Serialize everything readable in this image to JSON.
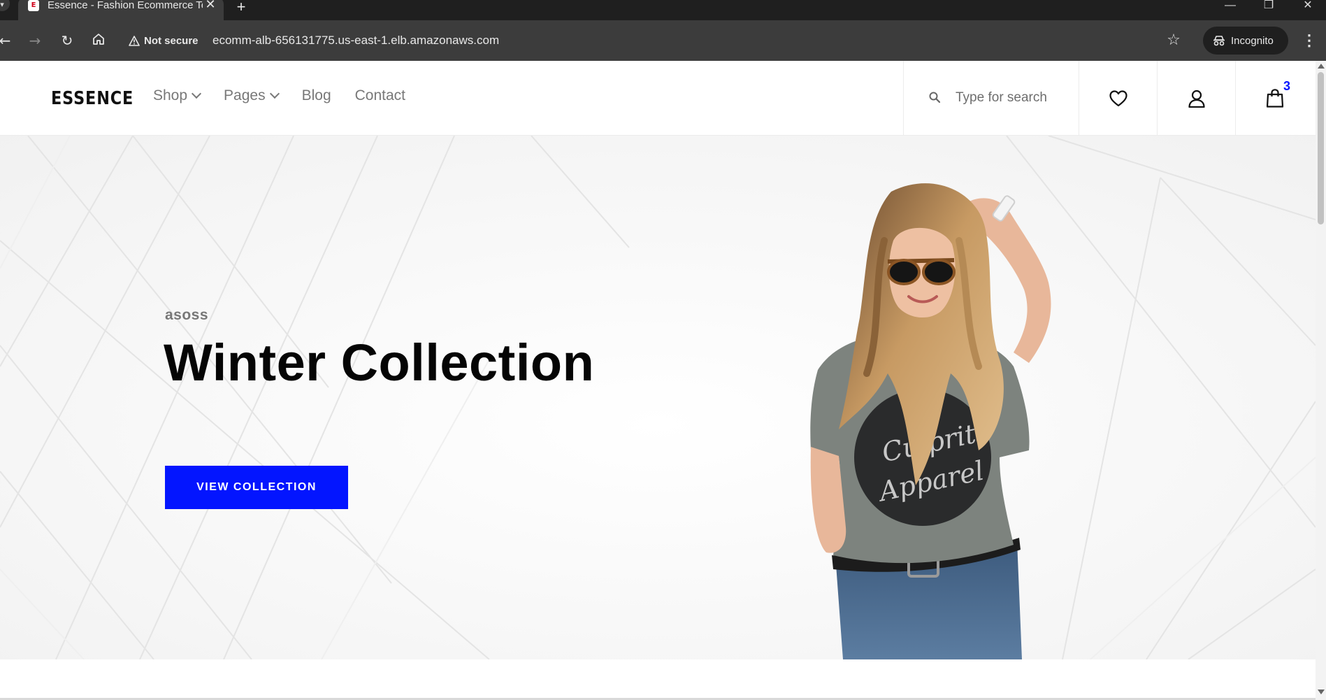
{
  "browser": {
    "tab": {
      "title": "Essence - Fashion Ecommerce Template",
      "favicon_letter": "E"
    },
    "new_tab_label": "+",
    "security_label": "Not secure",
    "url": "ecomm-alb-656131775.us-east-1.elb.amazonaws.com",
    "profile_label": "Incognito"
  },
  "site": {
    "logo": "ESSENCE",
    "nav": [
      {
        "label": "Shop",
        "has_dropdown": true
      },
      {
        "label": "Pages",
        "has_dropdown": true
      },
      {
        "label": "Blog",
        "has_dropdown": false
      },
      {
        "label": "Contact",
        "has_dropdown": false
      }
    ],
    "search": {
      "placeholder": "Type for search",
      "value": ""
    },
    "icons": [
      "search-icon",
      "heart-icon",
      "user-icon",
      "shopping-bag-icon"
    ],
    "cart_count": "3"
  },
  "hero": {
    "eyebrow": "asoss",
    "title": "Winter Collection",
    "button_label": "VIEW COLLECTION",
    "model_shirt_text": "Culprit Apparel"
  },
  "colors": {
    "accent": "#0315ff",
    "chrome_dark": "#1f1f1f",
    "chrome_toolbar": "#3c3c3c"
  }
}
